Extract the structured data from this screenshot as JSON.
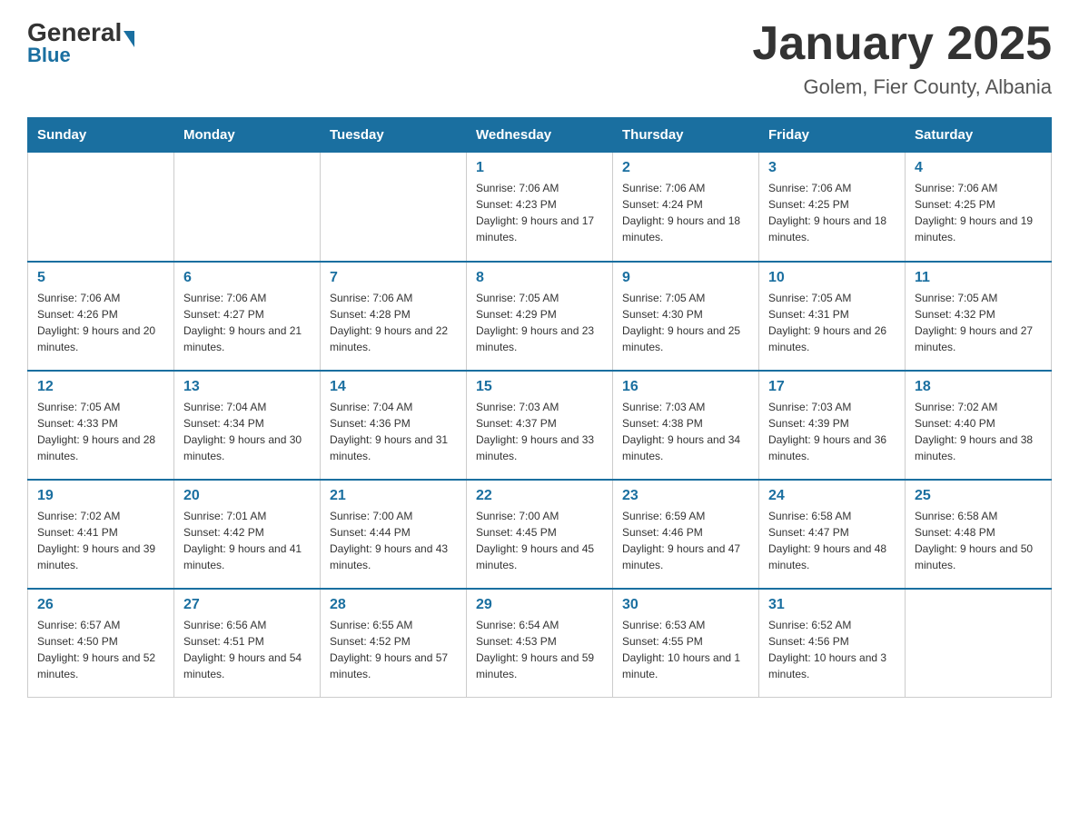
{
  "header": {
    "logo_general": "General",
    "logo_blue": "Blue",
    "title": "January 2025",
    "subtitle": "Golem, Fier County, Albania"
  },
  "days_of_week": [
    "Sunday",
    "Monday",
    "Tuesday",
    "Wednesday",
    "Thursday",
    "Friday",
    "Saturday"
  ],
  "weeks": [
    [
      {
        "day": "",
        "info": ""
      },
      {
        "day": "",
        "info": ""
      },
      {
        "day": "",
        "info": ""
      },
      {
        "day": "1",
        "info": "Sunrise: 7:06 AM\nSunset: 4:23 PM\nDaylight: 9 hours and 17 minutes."
      },
      {
        "day": "2",
        "info": "Sunrise: 7:06 AM\nSunset: 4:24 PM\nDaylight: 9 hours and 18 minutes."
      },
      {
        "day": "3",
        "info": "Sunrise: 7:06 AM\nSunset: 4:25 PM\nDaylight: 9 hours and 18 minutes."
      },
      {
        "day": "4",
        "info": "Sunrise: 7:06 AM\nSunset: 4:25 PM\nDaylight: 9 hours and 19 minutes."
      }
    ],
    [
      {
        "day": "5",
        "info": "Sunrise: 7:06 AM\nSunset: 4:26 PM\nDaylight: 9 hours and 20 minutes."
      },
      {
        "day": "6",
        "info": "Sunrise: 7:06 AM\nSunset: 4:27 PM\nDaylight: 9 hours and 21 minutes."
      },
      {
        "day": "7",
        "info": "Sunrise: 7:06 AM\nSunset: 4:28 PM\nDaylight: 9 hours and 22 minutes."
      },
      {
        "day": "8",
        "info": "Sunrise: 7:05 AM\nSunset: 4:29 PM\nDaylight: 9 hours and 23 minutes."
      },
      {
        "day": "9",
        "info": "Sunrise: 7:05 AM\nSunset: 4:30 PM\nDaylight: 9 hours and 25 minutes."
      },
      {
        "day": "10",
        "info": "Sunrise: 7:05 AM\nSunset: 4:31 PM\nDaylight: 9 hours and 26 minutes."
      },
      {
        "day": "11",
        "info": "Sunrise: 7:05 AM\nSunset: 4:32 PM\nDaylight: 9 hours and 27 minutes."
      }
    ],
    [
      {
        "day": "12",
        "info": "Sunrise: 7:05 AM\nSunset: 4:33 PM\nDaylight: 9 hours and 28 minutes."
      },
      {
        "day": "13",
        "info": "Sunrise: 7:04 AM\nSunset: 4:34 PM\nDaylight: 9 hours and 30 minutes."
      },
      {
        "day": "14",
        "info": "Sunrise: 7:04 AM\nSunset: 4:36 PM\nDaylight: 9 hours and 31 minutes."
      },
      {
        "day": "15",
        "info": "Sunrise: 7:03 AM\nSunset: 4:37 PM\nDaylight: 9 hours and 33 minutes."
      },
      {
        "day": "16",
        "info": "Sunrise: 7:03 AM\nSunset: 4:38 PM\nDaylight: 9 hours and 34 minutes."
      },
      {
        "day": "17",
        "info": "Sunrise: 7:03 AM\nSunset: 4:39 PM\nDaylight: 9 hours and 36 minutes."
      },
      {
        "day": "18",
        "info": "Sunrise: 7:02 AM\nSunset: 4:40 PM\nDaylight: 9 hours and 38 minutes."
      }
    ],
    [
      {
        "day": "19",
        "info": "Sunrise: 7:02 AM\nSunset: 4:41 PM\nDaylight: 9 hours and 39 minutes."
      },
      {
        "day": "20",
        "info": "Sunrise: 7:01 AM\nSunset: 4:42 PM\nDaylight: 9 hours and 41 minutes."
      },
      {
        "day": "21",
        "info": "Sunrise: 7:00 AM\nSunset: 4:44 PM\nDaylight: 9 hours and 43 minutes."
      },
      {
        "day": "22",
        "info": "Sunrise: 7:00 AM\nSunset: 4:45 PM\nDaylight: 9 hours and 45 minutes."
      },
      {
        "day": "23",
        "info": "Sunrise: 6:59 AM\nSunset: 4:46 PM\nDaylight: 9 hours and 47 minutes."
      },
      {
        "day": "24",
        "info": "Sunrise: 6:58 AM\nSunset: 4:47 PM\nDaylight: 9 hours and 48 minutes."
      },
      {
        "day": "25",
        "info": "Sunrise: 6:58 AM\nSunset: 4:48 PM\nDaylight: 9 hours and 50 minutes."
      }
    ],
    [
      {
        "day": "26",
        "info": "Sunrise: 6:57 AM\nSunset: 4:50 PM\nDaylight: 9 hours and 52 minutes."
      },
      {
        "day": "27",
        "info": "Sunrise: 6:56 AM\nSunset: 4:51 PM\nDaylight: 9 hours and 54 minutes."
      },
      {
        "day": "28",
        "info": "Sunrise: 6:55 AM\nSunset: 4:52 PM\nDaylight: 9 hours and 57 minutes."
      },
      {
        "day": "29",
        "info": "Sunrise: 6:54 AM\nSunset: 4:53 PM\nDaylight: 9 hours and 59 minutes."
      },
      {
        "day": "30",
        "info": "Sunrise: 6:53 AM\nSunset: 4:55 PM\nDaylight: 10 hours and 1 minute."
      },
      {
        "day": "31",
        "info": "Sunrise: 6:52 AM\nSunset: 4:56 PM\nDaylight: 10 hours and 3 minutes."
      },
      {
        "day": "",
        "info": ""
      }
    ]
  ]
}
